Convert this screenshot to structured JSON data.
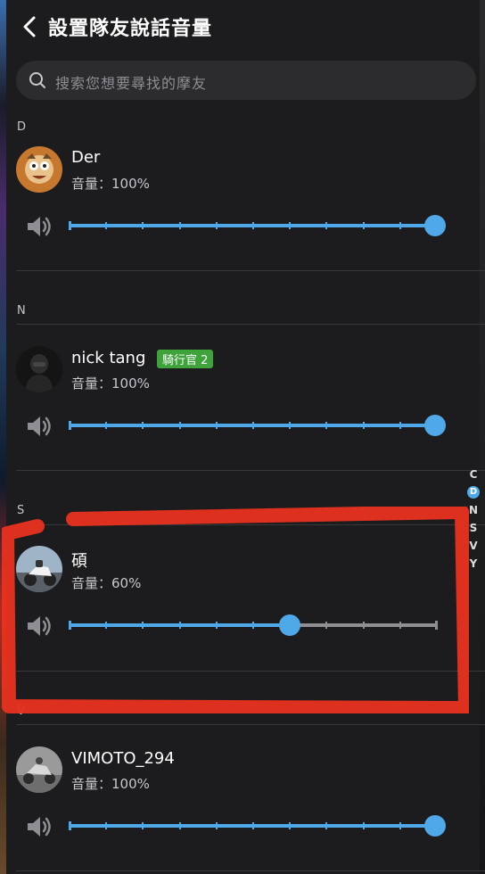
{
  "header": {
    "title": "設置隊友說話音量",
    "back_icon": "chevron-left-icon"
  },
  "search": {
    "placeholder": "搜索您想要尋找的摩友",
    "icon": "search-icon"
  },
  "sections": [
    {
      "letter": "D",
      "friends": [
        {
          "name": "Der",
          "volume_text": "音量：100%",
          "volume": 100
        }
      ]
    },
    {
      "letter": "N",
      "friends": [
        {
          "name": "nick tang",
          "badge": "騎行官 2",
          "volume_text": "音量：100%",
          "volume": 100
        }
      ]
    },
    {
      "letter": "S",
      "friends": [
        {
          "name": "碩",
          "volume_text": "音量：60%",
          "volume": 60
        }
      ]
    },
    {
      "letter": "V",
      "friends": [
        {
          "name": "VIMOTO_294",
          "volume_text": "音量：100%",
          "volume": 100
        }
      ]
    }
  ],
  "index_bar": [
    "C",
    "D",
    "N",
    "S",
    "V",
    "Y"
  ],
  "index_active": "D",
  "colors": {
    "accent": "#4fa8e8",
    "badge": "#3ea33a",
    "background": "#1c1c1e",
    "annotation": "#e8321f"
  }
}
